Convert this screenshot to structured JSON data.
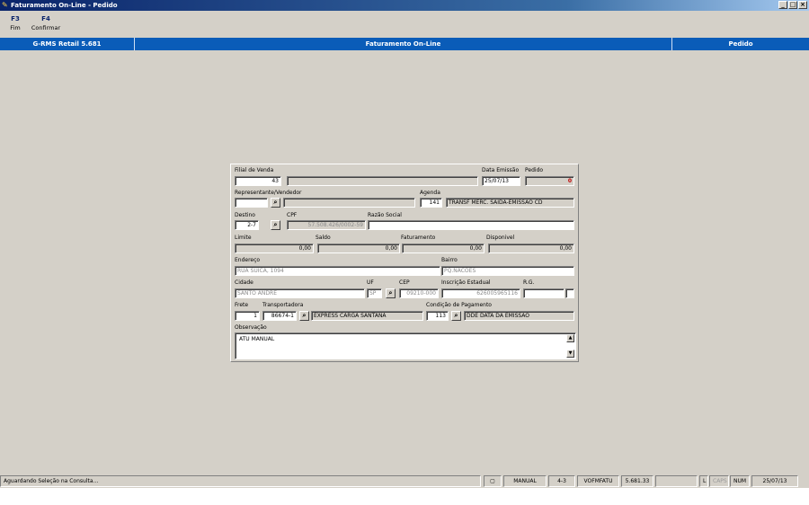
{
  "window": {
    "title": "Faturamento On-Line - Pedido",
    "controls": [
      "_",
      "□",
      "×"
    ]
  },
  "toolbar": [
    {
      "key": "F3",
      "label": "Fim"
    },
    {
      "key": "F4",
      "label": "Confirmar"
    }
  ],
  "infobar": {
    "product": "G-RMS Retail 5.681",
    "module": "Faturamento On-Line",
    "screen": "Pedido"
  },
  "form": {
    "filial_label": "Filial de Venda",
    "filial_value": "43",
    "filial_name": "",
    "data_emissao_label": "Data Emissão",
    "data_emissao_value": "25/07/13",
    "pedido_label": "Pedido",
    "pedido_value": "0",
    "representante_label": "Representante/Vendedor",
    "representante_value": "",
    "representante_name": "",
    "agenda_label": "Agenda",
    "agenda_value": "141",
    "agenda_desc": "TRANSF MERC. SAIDA-EMISSAO CD",
    "destino_label": "Destino",
    "destino_value": "2-7",
    "cpf_label": "CPF",
    "cpf_value": "57.508.426/0002-59",
    "razao_label": "Razão Social",
    "razao_value": "",
    "limite_label": "Limite",
    "limite_value": "0,00",
    "saldo_label": "Saldo",
    "saldo_value": "0,00",
    "faturamento_label": "Faturamento",
    "faturamento_value": "0,00",
    "disponivel_label": "Disponivel",
    "disponivel_value": "0,00",
    "endereco_label": "Endereço",
    "endereco_value": "RUA SUICA, 1094",
    "bairro_label": "Bairro",
    "bairro_value": "PQ.NACOES",
    "cidade_label": "Cidade",
    "cidade_value": "SANTO ANDRE",
    "uf_label": "UF",
    "uf_value": "SP",
    "cep_label": "CEP",
    "cep_value": "09210-000",
    "ie_label": "Inscrição Estadual",
    "ie_value": "626005965116",
    "rg_label": "R.G.",
    "rg_value": "",
    "frete_label": "Frete",
    "frete_value": "1",
    "transportadora_label": "Transportadora",
    "transportadora_code": "86674-1",
    "transportadora_name": "EXPRESS CARGA SANTANA",
    "condicao_label": "Condição de Pagamento",
    "condicao_code": "113",
    "condicao_desc": "DDE  DATA DA EMISSAO",
    "observacao_label": "Observação",
    "observacao_value": "ATU MANUAL"
  },
  "icons": {
    "lookup": "binoculars-icon"
  },
  "statusbar": {
    "message": "Aguardando Seleção na Consulta...",
    "mode": "MANUAL",
    "version_code": "4-3",
    "program": "VOFMFATU",
    "build": "5.681.33",
    "blank": "",
    "l": "L",
    "caps": "CAPS",
    "num": "NUM",
    "date": "25/07/13"
  },
  "colors": {
    "title_bar": "#0a246a",
    "info_bar": "#0a5cb8",
    "window_bg": "#d4d0c8",
    "pedido_value": "#c00000"
  }
}
